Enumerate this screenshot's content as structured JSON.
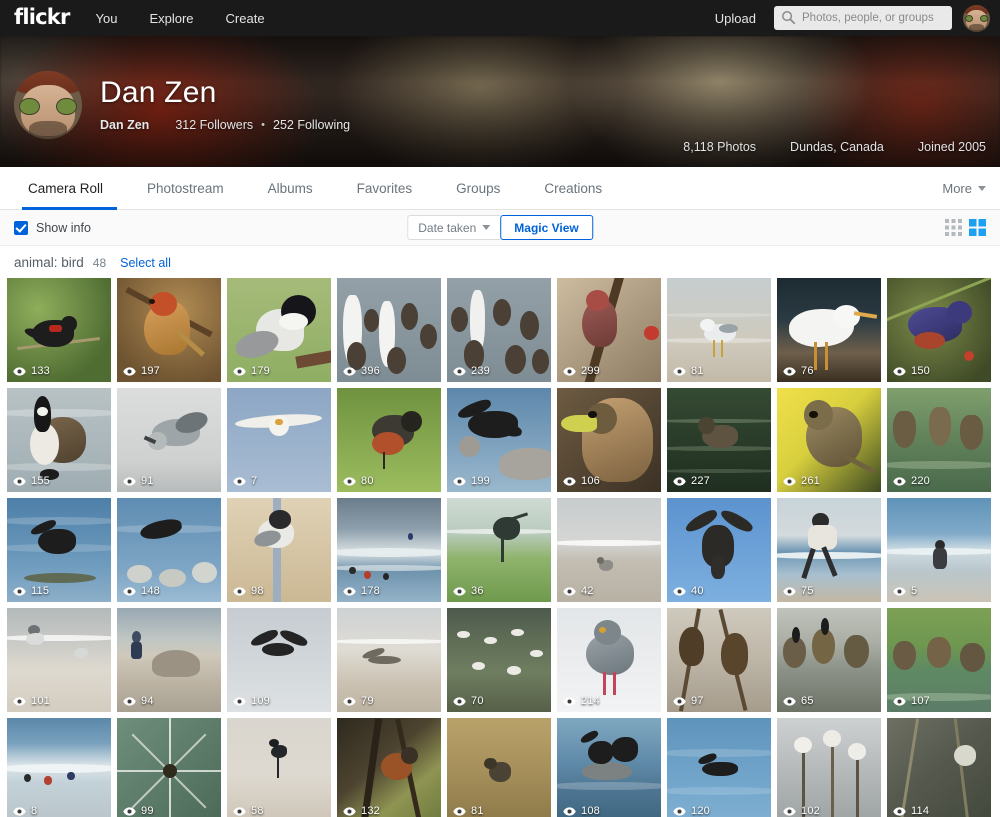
{
  "topnav": {
    "brand": "flickr",
    "links": [
      {
        "label": "You",
        "name": "nav-you"
      },
      {
        "label": "Explore",
        "name": "nav-explore"
      },
      {
        "label": "Create",
        "name": "nav-create"
      }
    ],
    "upload_label": "Upload",
    "search_placeholder": "Photos, people, or groups",
    "search_value": "",
    "search_icon": "search-icon",
    "avatar_icon": "user-avatar"
  },
  "profile": {
    "display_name": "Dan Zen",
    "username": "Dan Zen",
    "followers": "312 Followers",
    "separator": "•",
    "following": "252 Following",
    "photos": "8,118 Photos",
    "location": "Dundas, Canada",
    "joined": "Joined 2005"
  },
  "tabs": {
    "items": [
      {
        "label": "Camera Roll",
        "active": true
      },
      {
        "label": "Photostream",
        "active": false
      },
      {
        "label": "Albums",
        "active": false
      },
      {
        "label": "Favorites",
        "active": false
      },
      {
        "label": "Groups",
        "active": false
      },
      {
        "label": "Creations",
        "active": false
      }
    ],
    "more_label": "More",
    "active_color": "#0063dc"
  },
  "toolbar": {
    "show_info_label": "Show info",
    "show_info_checked": true,
    "sort_label": "Date taken",
    "magic_view_label": "Magic View",
    "view_modes": [
      {
        "name": "grid-small-icon",
        "selected": false
      },
      {
        "name": "grid-large-icon",
        "selected": true
      }
    ],
    "accent_color": "#0063dc"
  },
  "tagline": {
    "tag": "animal: bird",
    "count": "48",
    "select_all": "Select all"
  },
  "grid": {
    "columns": 9,
    "view_icon": "eye-icon",
    "photos": [
      {
        "views": "133",
        "alt": "red-winged blackbird on reeds",
        "art": "blackbird"
      },
      {
        "views": "197",
        "alt": "house finch on branch",
        "art": "finch"
      },
      {
        "views": "179",
        "alt": "chickadee on feeder",
        "art": "chickadee"
      },
      {
        "views": "396",
        "alt": "flock of geese and swans",
        "art": "flock"
      },
      {
        "views": "239",
        "alt": "geese and swans on water",
        "art": "flock2"
      },
      {
        "views": "299",
        "alt": "purple finch on branch",
        "art": "purplefinch"
      },
      {
        "views": "81",
        "alt": "gull standing on shore",
        "art": "gullshore"
      },
      {
        "views": "76",
        "alt": "white egret flying",
        "art": "egret"
      },
      {
        "views": "150",
        "alt": "blue bird on branch",
        "art": "bluebird"
      },
      {
        "views": "155",
        "alt": "canada goose standing in water",
        "art": "goose"
      },
      {
        "views": "91",
        "alt": "gull diving in fog",
        "art": "gullfog"
      },
      {
        "views": "7",
        "alt": "gull flying against blue sky",
        "art": "gullsky"
      },
      {
        "views": "80",
        "alt": "robin on grass",
        "art": "robin"
      },
      {
        "views": "199",
        "alt": "cormorant landing on rocks",
        "art": "cormorant"
      },
      {
        "views": "106",
        "alt": "mallard duck portrait",
        "art": "mallard"
      },
      {
        "views": "227",
        "alt": "duck swimming in dark water",
        "art": "duckdark"
      },
      {
        "views": "261",
        "alt": "sparrow on yellow background",
        "art": "sparrow"
      },
      {
        "views": "220",
        "alt": "geese wading in pond",
        "art": "geesepond"
      },
      {
        "views": "115",
        "alt": "cormorant on lake edge",
        "art": "lakebird"
      },
      {
        "views": "148",
        "alt": "bird over rocks in lake",
        "art": "rockbird"
      },
      {
        "views": "98",
        "alt": "chickadee on post",
        "art": "postbird"
      },
      {
        "views": "178",
        "alt": "surfers and birds at beach",
        "art": "surf"
      },
      {
        "views": "36",
        "alt": "heron in marsh grass",
        "art": "heron"
      },
      {
        "views": "42",
        "alt": "sandpiper on wet sand",
        "art": "sandpiper"
      },
      {
        "views": "40",
        "alt": "osprey flying in blue sky",
        "art": "osprey"
      },
      {
        "views": "75",
        "alt": "person jumping on beach",
        "art": "jump"
      },
      {
        "views": "5",
        "alt": "person on beach by ocean",
        "art": "beachperson"
      },
      {
        "views": "101",
        "alt": "gulls on wet beach",
        "art": "gullsbeach"
      },
      {
        "views": "94",
        "alt": "person and rock on shoreline",
        "art": "shorerock"
      },
      {
        "views": "109",
        "alt": "tern flying over grey sky",
        "art": "tern"
      },
      {
        "views": "79",
        "alt": "bird flying low over sand",
        "art": "lowflight"
      },
      {
        "views": "70",
        "alt": "flock of gulls on water",
        "art": "gullflock"
      },
      {
        "views": "214",
        "alt": "pigeon standing in snow",
        "art": "pigeon"
      },
      {
        "views": "97",
        "alt": "blackbirds on seed pods",
        "art": "podbirds"
      },
      {
        "views": "65",
        "alt": "canada geese on shore",
        "art": "geeseshore"
      },
      {
        "views": "107",
        "alt": "geese flock on grass by water",
        "art": "geesegrass"
      },
      {
        "views": "8",
        "alt": "swimmers in ocean surf",
        "art": "swimmers"
      },
      {
        "views": "99",
        "alt": "spider web detail",
        "art": "spider"
      },
      {
        "views": "58",
        "alt": "tern on pale sand",
        "art": "ternsand"
      },
      {
        "views": "132",
        "alt": "robin in tree branches",
        "art": "treerobin"
      },
      {
        "views": "81",
        "alt": "small bird in dry grass",
        "art": "grassbird"
      },
      {
        "views": "108",
        "alt": "cormorants on rock in water",
        "art": "rockcormorant"
      },
      {
        "views": "120",
        "alt": "loon on blue water",
        "art": "loon"
      },
      {
        "views": "102",
        "alt": "seed heads against sky",
        "art": "seedheads"
      },
      {
        "views": "114",
        "alt": "bird in winter reeds",
        "art": "winterbird"
      }
    ]
  }
}
